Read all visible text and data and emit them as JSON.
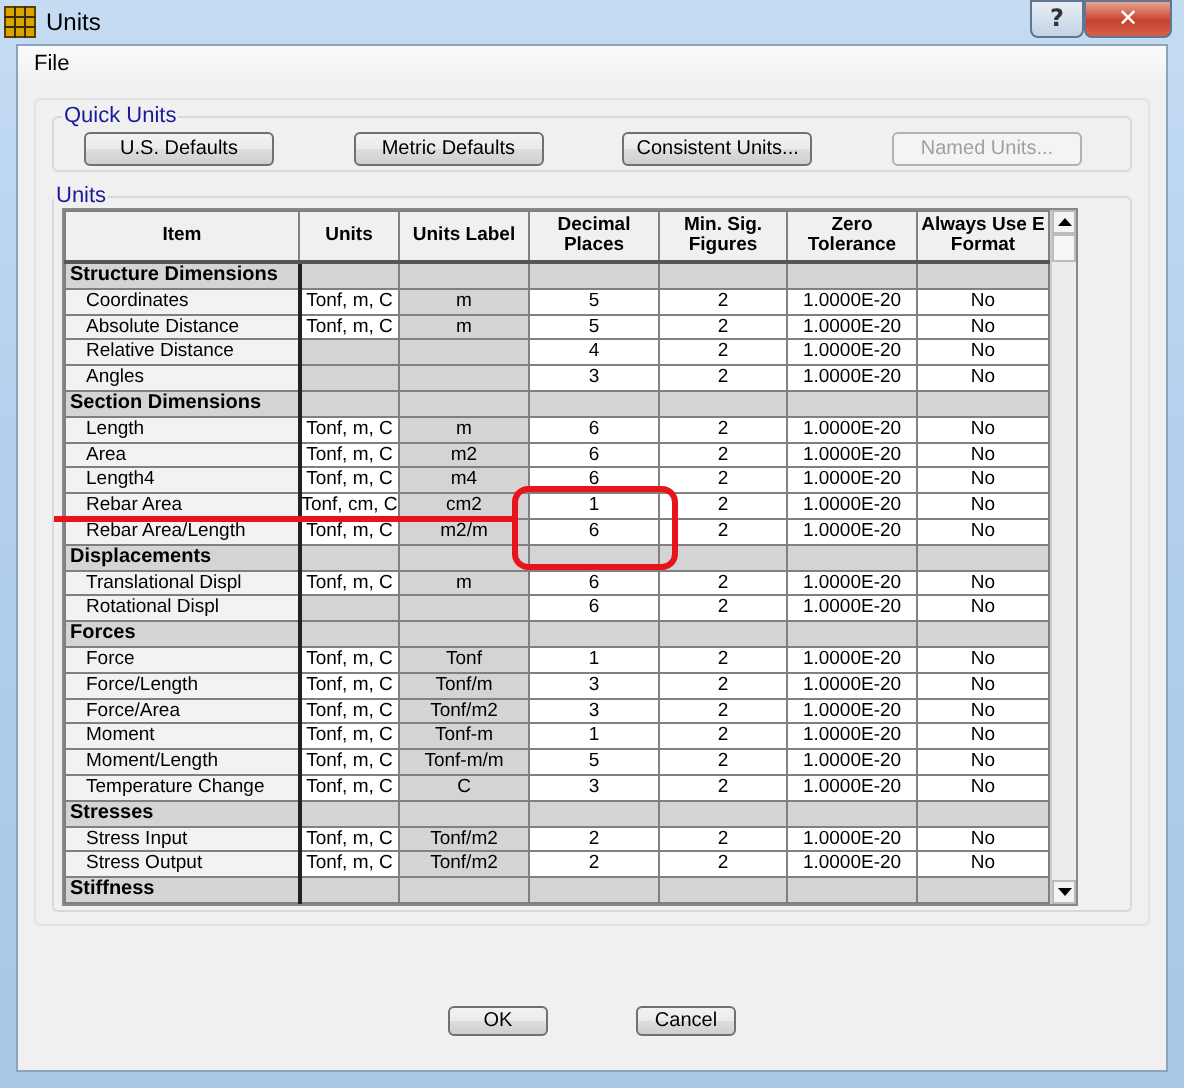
{
  "window": {
    "title": "Units",
    "controls": [
      {
        "kind": "help",
        "symbol": "?"
      },
      {
        "kind": "close",
        "symbol": "✕"
      }
    ]
  },
  "menu": [
    "File"
  ],
  "quick_units": {
    "title": "Quick Units",
    "buttons": [
      {
        "label": "U.S. Defaults",
        "disabled": false
      },
      {
        "label": "Metric Defaults",
        "disabled": false
      },
      {
        "label": "Consistent Units...",
        "disabled": false
      },
      {
        "label": "Named Units...",
        "disabled": true
      }
    ]
  },
  "units": {
    "title": "Units",
    "table": {
      "columns": [
        "Item",
        "Units",
        "Units Label",
        "Decimal Places",
        "Min. Sig. Figures",
        "Zero Tolerance",
        "Always Use E Format"
      ],
      "groups": [
        {
          "name": "Structure Dimensions",
          "rows": [
            [
              "Coordinates",
              "Tonf, m, C",
              "m",
              "5",
              "2",
              "1.0000E-20",
              "No"
            ],
            [
              "Absolute Distance",
              "Tonf, m, C",
              "m",
              "5",
              "2",
              "1.0000E-20",
              "No"
            ],
            [
              "Relative Distance",
              null,
              null,
              "4",
              "2",
              "1.0000E-20",
              "No"
            ],
            [
              "Angles",
              null,
              null,
              "3",
              "2",
              "1.0000E-20",
              "No"
            ]
          ]
        },
        {
          "name": "Section Dimensions",
          "rows": [
            [
              "Length",
              "Tonf, m, C",
              "m",
              "6",
              "2",
              "1.0000E-20",
              "No"
            ],
            [
              "Area",
              "Tonf, m, C",
              "m2",
              "6",
              "2",
              "1.0000E-20",
              "No"
            ],
            [
              "Length4",
              "Tonf, m, C",
              "m4",
              "6",
              "2",
              "1.0000E-20",
              "No"
            ],
            [
              "Rebar Area",
              "Tonf, cm, C",
              "cm2",
              "1",
              "2",
              "1.0000E-20",
              "No"
            ],
            [
              "Rebar Area/Length",
              "Tonf, m, C",
              "m2/m",
              "6",
              "2",
              "1.0000E-20",
              "No"
            ]
          ]
        },
        {
          "name": "Displacements",
          "rows": [
            [
              "Translational Displ",
              "Tonf, m, C",
              "m",
              "6",
              "2",
              "1.0000E-20",
              "No"
            ],
            [
              "Rotational Displ",
              null,
              null,
              "6",
              "2",
              "1.0000E-20",
              "No"
            ]
          ]
        },
        {
          "name": "Forces",
          "rows": [
            [
              "Force",
              "Tonf, m, C",
              "Tonf",
              "1",
              "2",
              "1.0000E-20",
              "No"
            ],
            [
              "Force/Length",
              "Tonf, m, C",
              "Tonf/m",
              "3",
              "2",
              "1.0000E-20",
              "No"
            ],
            [
              "Force/Area",
              "Tonf, m, C",
              "Tonf/m2",
              "3",
              "2",
              "1.0000E-20",
              "No"
            ],
            [
              "Moment",
              "Tonf, m, C",
              "Tonf-m",
              "1",
              "2",
              "1.0000E-20",
              "No"
            ],
            [
              "Moment/Length",
              "Tonf, m, C",
              "Tonf-m/m",
              "5",
              "2",
              "1.0000E-20",
              "No"
            ],
            [
              "Temperature Change",
              "Tonf, m, C",
              "C",
              "3",
              "2",
              "1.0000E-20",
              "No"
            ]
          ]
        },
        {
          "name": "Stresses",
          "rows": [
            [
              "Stress Input",
              "Tonf, m, C",
              "Tonf/m2",
              "2",
              "2",
              "1.0000E-20",
              "No"
            ],
            [
              "Stress Output",
              "Tonf, m, C",
              "Tonf/m2",
              "2",
              "2",
              "1.0000E-20",
              "No"
            ]
          ]
        },
        {
          "name": "Stiffness"
        }
      ]
    }
  },
  "annotations": {
    "line": true,
    "rectangle": true
  },
  "buttons": [
    "OK",
    "Cancel"
  ]
}
